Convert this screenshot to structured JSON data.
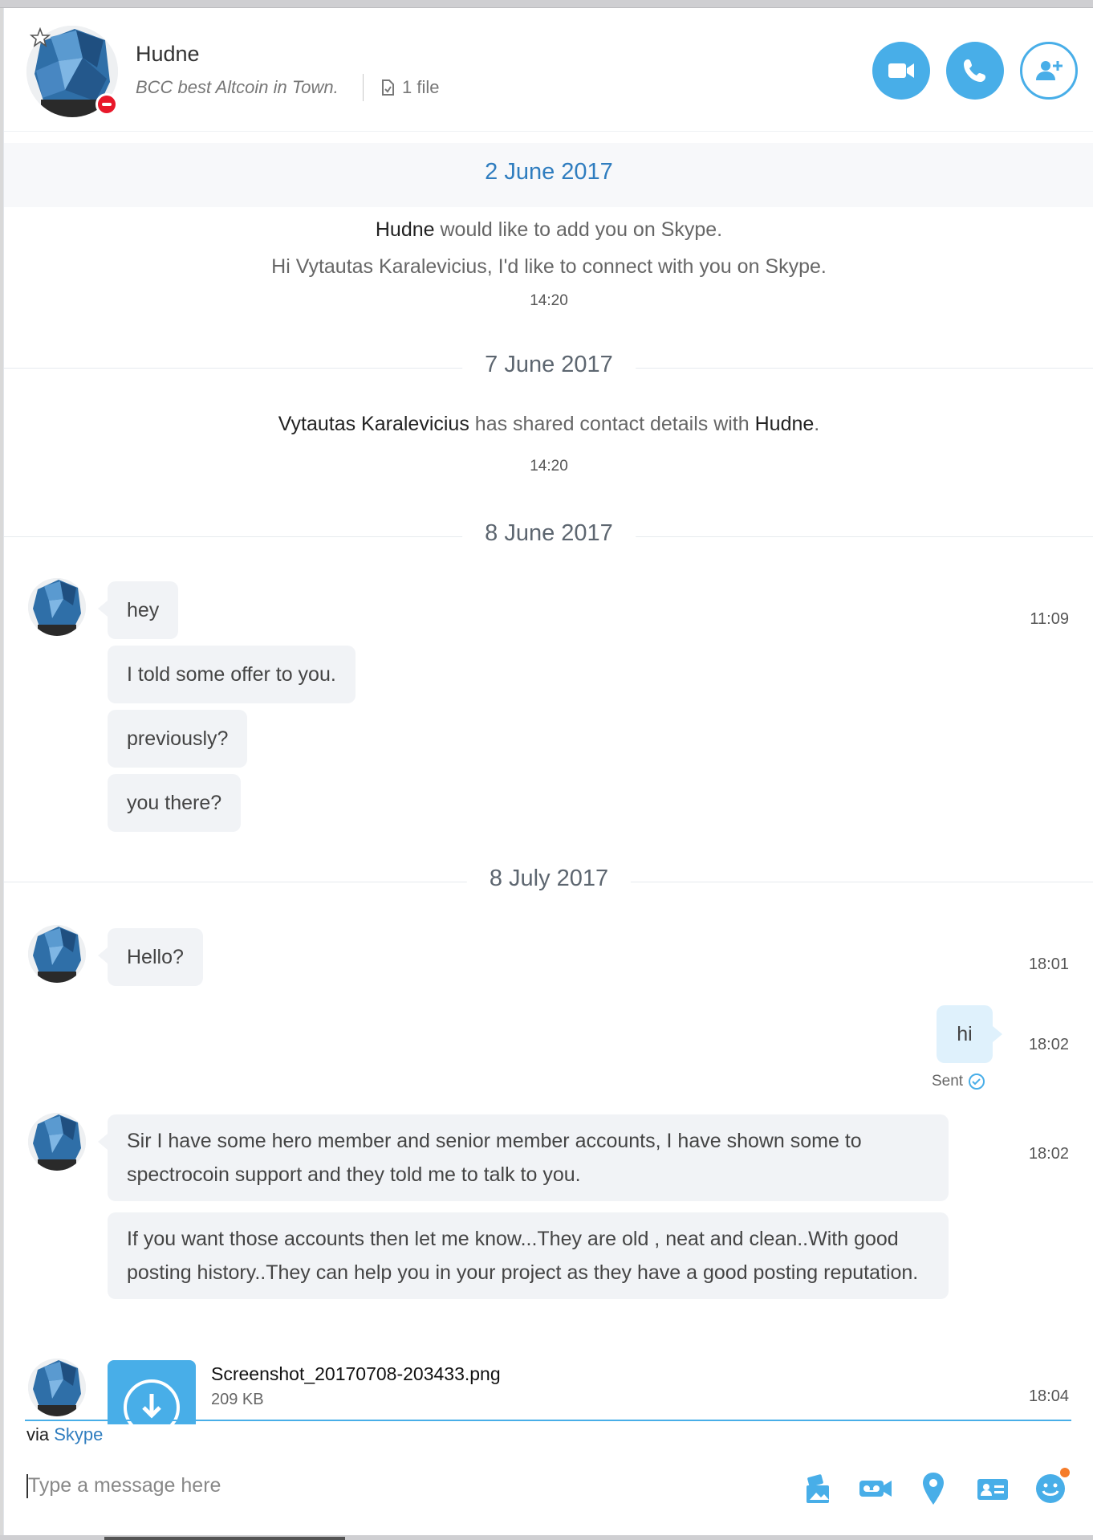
{
  "header": {
    "contact_name": "Hudne",
    "mood": "BCC best Altcoin in Town.",
    "files": "1 file",
    "accent": "#48aee8"
  },
  "timeline": {
    "sep1": "2 June 2017",
    "contact_request": {
      "name": "Hudne",
      "action": "would like to add you on Skype.",
      "greeting": "Hi Vytautas Karalevicius, I'd like to connect with you on Skype.",
      "time": "14:20"
    },
    "sep2": "7 June 2017",
    "shared": {
      "from": "Vytautas Karalevicius",
      "action": "has shared contact details with",
      "to": "Hudne",
      "end": ".",
      "time": "14:20"
    },
    "sep3": "8 June 2017",
    "group1": {
      "messages": [
        "hey",
        "I told some offer to you.",
        "previously?",
        "you there?"
      ],
      "time": "11:09"
    },
    "sep4": "8 July 2017",
    "group2": {
      "messages": [
        "Hello?"
      ],
      "time": "18:01"
    },
    "outgoing": {
      "text": "hi",
      "time": "18:02",
      "status": "Sent"
    },
    "group3": {
      "messages": [
        "Sir I have some hero member and senior member accounts, I have shown some to spectrocoin support and they told me to talk to you.",
        "If you want those accounts then let me know...They are old , neat and clean..With good posting history..They can help you in your project as they have a good posting reputation."
      ],
      "time": "18:02"
    },
    "file": {
      "name": "Screenshot_20170708-203433.png",
      "size": "209 KB",
      "time": "18:04"
    }
  },
  "compose": {
    "via_prefix": "via",
    "via_link": "Skype",
    "placeholder": "Type a message here",
    "tools": [
      "send-media-icon",
      "video-message-icon",
      "location-icon",
      "contact-card-icon",
      "emoji-icon"
    ]
  }
}
